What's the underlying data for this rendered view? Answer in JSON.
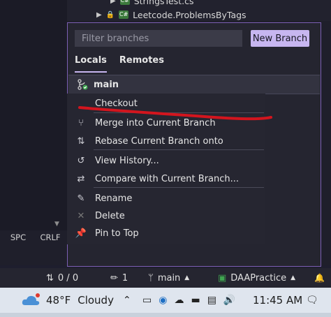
{
  "tree": {
    "file_partial": "StringsTest.cs",
    "project": "Leetcode.ProblemsByTags"
  },
  "status_left": {
    "spc": "SPC",
    "crlf": "CRLF"
  },
  "branch_popup": {
    "filter_placeholder": "Filter branches",
    "new_branch_label": "New Branch",
    "tabs": [
      "Locals",
      "Remotes"
    ],
    "active_tab": "Locals",
    "current_branch": "main"
  },
  "context_menu": {
    "items": [
      {
        "label": "Checkout",
        "icon": "none"
      },
      {
        "label": "Merge into Current Branch",
        "icon": "merge-icon"
      },
      {
        "label": "Rebase Current Branch onto",
        "icon": "rebase-icon"
      },
      {
        "label": "View History...",
        "icon": "history-icon"
      },
      {
        "label": "Compare with Current Branch...",
        "icon": "compare-icon"
      },
      {
        "label": "Rename",
        "icon": "rename-icon"
      },
      {
        "label": "Delete",
        "icon": "delete-icon"
      },
      {
        "label": "Pin to Top",
        "icon": "pin-icon"
      }
    ]
  },
  "annotation": {
    "color": "#d3151e"
  },
  "statusbar": {
    "sync": "0 / 0",
    "changes": "1",
    "branch": "main",
    "repo": "DAAPractice"
  },
  "taskbar": {
    "temperature": "48°F",
    "weather": "Cloudy",
    "time": "11:45 AM"
  },
  "colors": {
    "accent": "#c7b6f0",
    "popup_border": "#7c5fb4",
    "taskbar_bg": "#dfe5ee"
  }
}
